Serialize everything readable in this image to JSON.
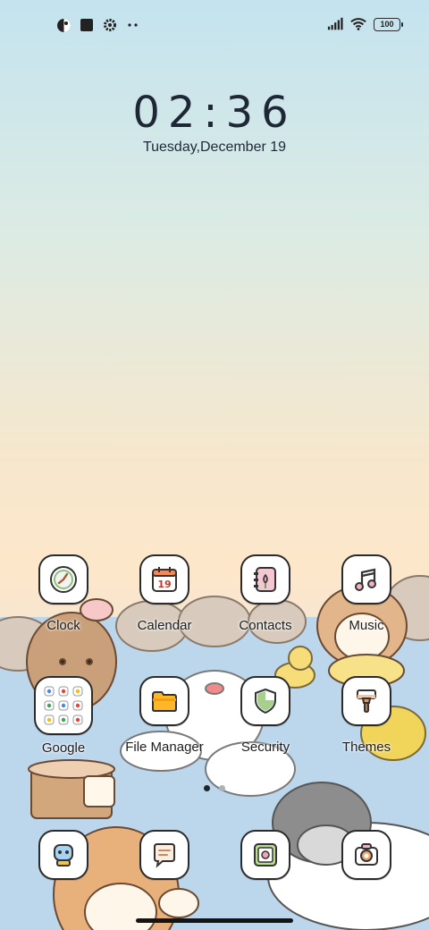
{
  "status_bar": {
    "left_icons": [
      "theme-icon",
      "square-icon",
      "settings-icon",
      "more-dots-icon"
    ],
    "right_icons": [
      "signal-icon",
      "wifi-icon",
      "battery-icon"
    ],
    "battery_level": "100"
  },
  "lockclock": {
    "time": "02:36",
    "date": "Tuesday,December 19"
  },
  "apps": {
    "row1": [
      {
        "label": "Clock"
      },
      {
        "label": "Calendar",
        "date_number": "19"
      },
      {
        "label": "Contacts"
      },
      {
        "label": "Music"
      }
    ],
    "row2": [
      {
        "label": "Google"
      },
      {
        "label": "File Manager"
      },
      {
        "label": "Security"
      },
      {
        "label": "Themes"
      }
    ]
  },
  "dock": [
    {
      "icon": "chat-assistant-icon"
    },
    {
      "icon": "messages-icon"
    },
    {
      "icon": "gallery-icon"
    },
    {
      "icon": "camera-icon"
    }
  ],
  "pager": {
    "pages": 2,
    "current": 1
  },
  "colors": {
    "icon_border": "#2b2b2b",
    "icon_background": "#ffffff",
    "text": "#1d2735"
  }
}
